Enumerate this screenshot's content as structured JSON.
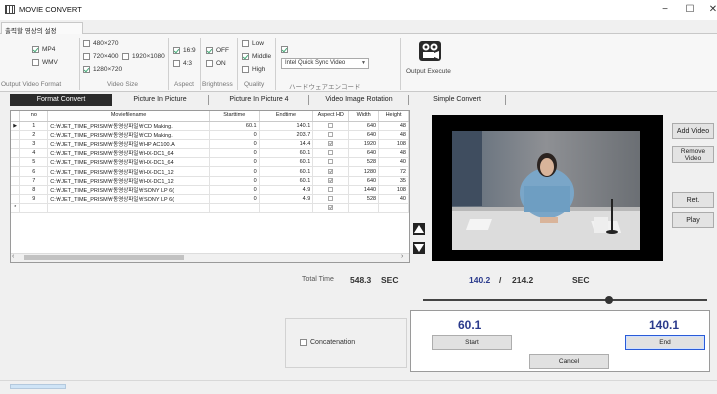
{
  "window": {
    "title": "MOVIE CONVERT",
    "minimize": "−",
    "maximize": "☐",
    "close": "✕"
  },
  "ribbon": {
    "tab": "출력할 영상의 설정",
    "groups": {
      "format": {
        "label": "Output Video Format",
        "options": [
          {
            "label": "MP4",
            "checked": true
          },
          {
            "label": "WMV",
            "checked": false
          }
        ]
      },
      "size": {
        "label": "Video Size",
        "options": [
          {
            "label": "480×270",
            "checked": false
          },
          {
            "label": "720×400",
            "checked": false
          },
          {
            "label": "1920×1080",
            "checked": false
          },
          {
            "label": "1280×720",
            "checked": true
          }
        ]
      },
      "aspect": {
        "label": "Aspect",
        "options": [
          {
            "label": "16:9",
            "checked": true
          },
          {
            "label": "4:3",
            "checked": false
          }
        ]
      },
      "brightness": {
        "label": "Brightness",
        "options": [
          {
            "label": "OFF",
            "checked": true
          },
          {
            "label": "ON",
            "checked": false
          }
        ]
      },
      "quality": {
        "label": "Quality",
        "options": [
          {
            "label": "Low",
            "checked": false
          },
          {
            "label": "Middle",
            "checked": true
          },
          {
            "label": "High",
            "checked": false
          }
        ]
      },
      "encoder": {
        "label": "ハードウェアエンコード",
        "checked": true,
        "value": "Intel Quick Sync Video",
        "caret": "▼"
      },
      "output": {
        "label": "Output Execute"
      }
    }
  },
  "feature_tabs": [
    "Format Convert",
    "Picture In Picture",
    "Picture In Picture 4",
    "Video Image Rotation",
    "Simple Convert"
  ],
  "grid": {
    "columns": [
      "no",
      "Moviefilename",
      "Starttime",
      "Endtime",
      "Aspect HD",
      "Width",
      "Height"
    ],
    "rows": [
      {
        "no": "1",
        "file": "C:￦JET_TIME_PRISM￦동영상파일￦CD Making.",
        "start": "60.1",
        "end": "140.1",
        "hd": false,
        "width": "640",
        "height": "48"
      },
      {
        "no": "2",
        "file": "C:￦JET_TIME_PRISM￦동영상파일￦CD Making.",
        "start": "0",
        "end": "203.7",
        "hd": false,
        "width": "640",
        "height": "48"
      },
      {
        "no": "3",
        "file": "C:￦JET_TIME_PRISM￦동영상파일￦HP AC100.A",
        "start": "0",
        "end": "14.4",
        "hd": true,
        "width": "1920",
        "height": "108"
      },
      {
        "no": "4",
        "file": "C:￦JET_TIME_PRISM￦동영상파일￦HX-DC1_64",
        "start": "0",
        "end": "60.1",
        "hd": false,
        "width": "640",
        "height": "48"
      },
      {
        "no": "5",
        "file": "C:￦JET_TIME_PRISM￦동영상파일￦HX-DC1_64",
        "start": "0",
        "end": "60.1",
        "hd": false,
        "width": "528",
        "height": "40"
      },
      {
        "no": "6",
        "file": "C:￦JET_TIME_PRISM￦동영상파일￦HX-DC1_12",
        "start": "0",
        "end": "60.1",
        "hd": true,
        "width": "1280",
        "height": "72"
      },
      {
        "no": "7",
        "file": "C:￦JET_TIME_PRISM￦동영상파일￦HX-DC1_12",
        "start": "0",
        "end": "60.1",
        "hd": true,
        "width": "640",
        "height": "35"
      },
      {
        "no": "8",
        "file": "C:￦JET_TIME_PRISM￦동영상파일￦SONY LP 6(",
        "start": "0",
        "end": "4.9",
        "hd": false,
        "width": "1440",
        "height": "108"
      },
      {
        "no": "9",
        "file": "C:￦JET_TIME_PRISM￦동영상파일￦SONY LP 6(",
        "start": "0",
        "end": "4.9",
        "hd": false,
        "width": "528",
        "height": "40"
      }
    ],
    "current_row_marker": "▶",
    "new_row_marker": "*",
    "scroll_left": "‹",
    "scroll_right": "›"
  },
  "side_buttons": {
    "add": "Add Video",
    "remove": "Remove Video",
    "reset": "Ret.",
    "play": "Play"
  },
  "status": {
    "total_label": "Total Time",
    "total_value": "548.3",
    "total_unit": "SEC",
    "current_time": "140.2",
    "separator": "/",
    "duration": "214.2",
    "time_unit": "SEC",
    "progress_fraction": 0.655
  },
  "concat": {
    "label": "Concatenation",
    "checked": false
  },
  "trim": {
    "start_value": "60.1",
    "end_value": "140.1",
    "start_label": "Start",
    "end_label": "End",
    "cancel_label": "Cancel"
  },
  "colors": {
    "accent_text": "#2a3a8c",
    "active_tab": "#2b2b2b",
    "focus_border": "#2a5bd7"
  }
}
